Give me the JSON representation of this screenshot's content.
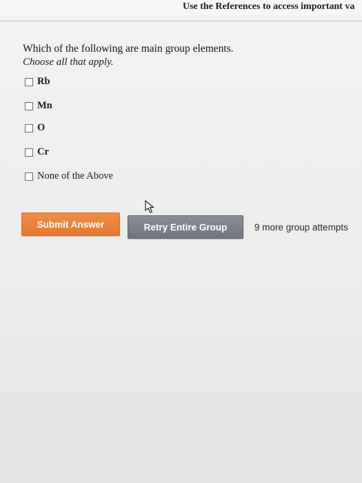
{
  "header": {
    "references_text": "Use the References to access important va"
  },
  "question": {
    "text": "Which of the following are main group elements.",
    "instruction": "Choose all that apply."
  },
  "options": [
    {
      "label": "Rb",
      "checked": false
    },
    {
      "label": "Mn",
      "checked": false
    },
    {
      "label": "O",
      "checked": false
    },
    {
      "label": "Cr",
      "checked": false
    },
    {
      "label": "None of the Above",
      "checked": false
    }
  ],
  "actions": {
    "submit_label": "Submit Answer",
    "retry_label": "Retry Entire Group",
    "attempts_text": "9 more group attempts"
  },
  "colors": {
    "submit": "#e87b2e",
    "retry": "#7a7f86"
  },
  "icons": {
    "cursor": "mouse-pointer-icon"
  }
}
